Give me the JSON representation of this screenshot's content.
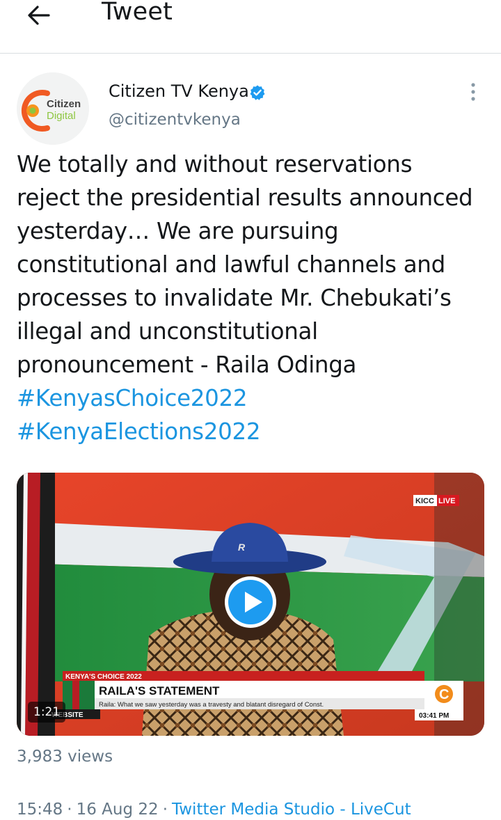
{
  "header": {
    "title": "Tweet",
    "back_icon": "arrow-left-icon"
  },
  "author": {
    "avatar_text_line1": "Citizen",
    "avatar_text_line2": "Digital",
    "display_name": "Citizen TV Kenya",
    "handle": "@citizentvkenya",
    "verified": true,
    "verified_icon": "verified-badge-icon",
    "menu_icon": "more-vertical-icon"
  },
  "tweet": {
    "lines": [
      "We totally and without reservations",
      "reject the presidential results announced",
      "yesterday… We are pursuing",
      "constitutional and lawful channels and",
      "processes to invalidate Mr. Chebukati’s",
      "illegal and unconstitutional",
      "pronouncement - Raila Odinga"
    ],
    "hashtags": [
      "#KenyasChoice2022",
      "#KenyaElections2022"
    ]
  },
  "video": {
    "duration": "1:21",
    "live_label": "KICC",
    "live_badge": "LIVE",
    "show_label": "KENYA'S CHOICE 2022",
    "headline": "RAILA'S STATEMENT",
    "ticker": "Raila: What we saw yesterday was a travesty and blatant disregard of Const.",
    "clock": "03:41 PM",
    "website_label": "WEBSITE",
    "channel_logo_letter": "C"
  },
  "stats": {
    "views": "3,983 views"
  },
  "meta": {
    "time": "15:48",
    "date": "16 Aug 22",
    "source": "Twitter Media Studio - LiveCut"
  },
  "colors": {
    "link": "#1b95e0",
    "secondary_text": "#657786",
    "primary_text": "#14171a",
    "verified": "#1d9bf0"
  }
}
